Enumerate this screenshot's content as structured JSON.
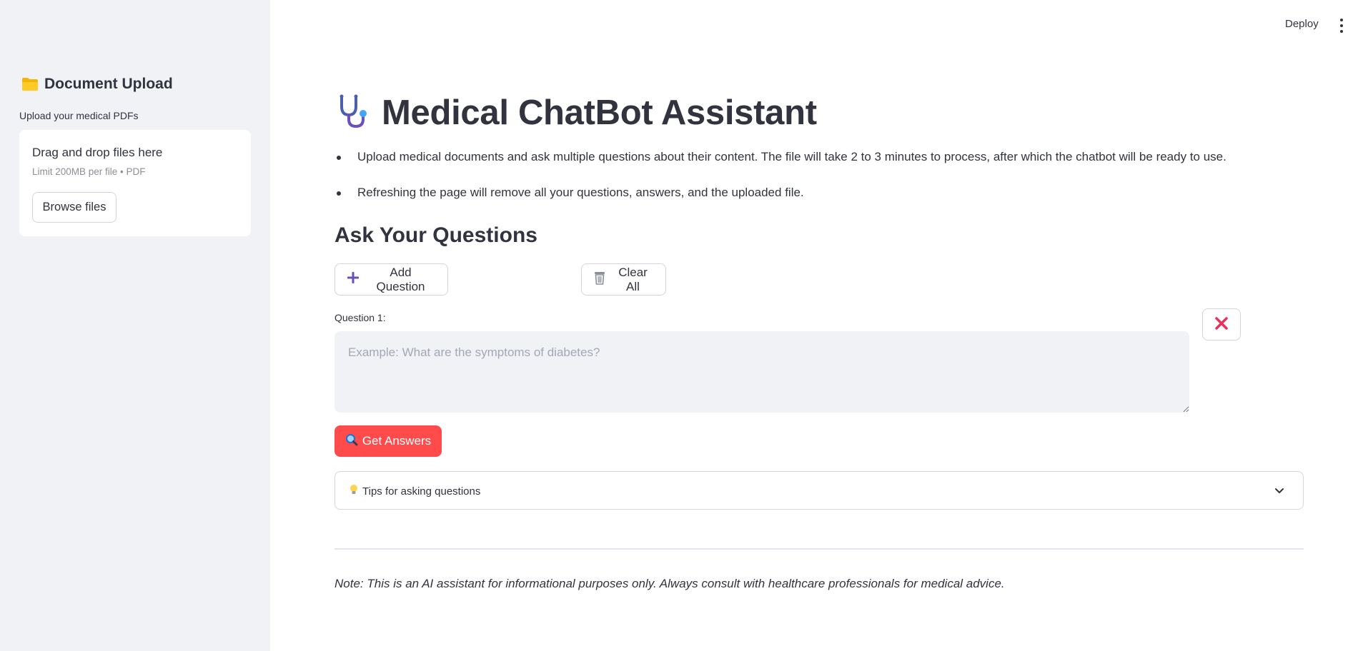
{
  "sidebar": {
    "title": "Document Upload",
    "title_icon": "folder-icon",
    "upload_label": "Upload your medical PDFs",
    "dropzone": {
      "title": "Drag and drop files here",
      "limit": "Limit 200MB per file • PDF",
      "browse_label": "Browse files"
    }
  },
  "header": {
    "deploy_label": "Deploy",
    "menu_icon": "kebab-menu-icon"
  },
  "main": {
    "title": "Medical ChatBot Assistant",
    "title_icon": "stethoscope-icon",
    "bullets": [
      "Upload medical documents and ask multiple questions about their content. The file will take 2 to 3 minutes to process, after which the chatbot will be ready to use.",
      "Refreshing the page will remove all your questions, answers, and the uploaded file."
    ],
    "section_heading": "Ask Your Questions",
    "add_question_label": "Add Question",
    "clear_all_label": "Clear All",
    "question_label": "Question 1:",
    "question_placeholder": "Example: What are the symptoms of diabetes?",
    "question_value": "",
    "get_answers_label": "Get Answers",
    "tips_label": "Tips for asking questions",
    "note": "Note: This is an AI assistant for informational purposes only. Always consult with healthcare professionals for medical advice."
  },
  "colors": {
    "sidebar_bg": "#f0f2f6",
    "primary_button": "#ff4b4b",
    "remove_icon": "#e8305b",
    "plus_icon": "#6b4fbb"
  }
}
